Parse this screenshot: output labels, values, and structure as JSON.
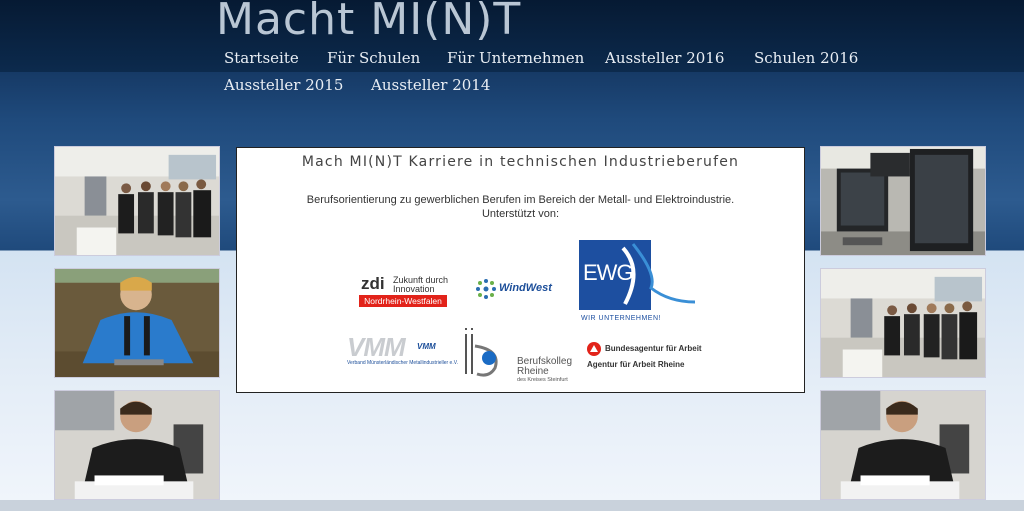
{
  "site": {
    "title": "Macht MI(N)T"
  },
  "nav": {
    "items": [
      {
        "label": "Startseite"
      },
      {
        "label": "Für Schulen"
      },
      {
        "label": "Für Unternehmen"
      },
      {
        "label": "Aussteller 2016"
      },
      {
        "label": "Schulen 2016"
      },
      {
        "label": "Aussteller 2015"
      },
      {
        "label": "Aussteller 2014"
      }
    ]
  },
  "content": {
    "title": "Mach MI(N)T  Karriere in technischen Industrieberufen",
    "line1": "Berufsorientierung zu gewerblichen Berufen im Bereich der Metall- und Elektroindustrie.",
    "line2": "Unterstützt von:"
  },
  "logos": {
    "zdi": {
      "mark": "zdi",
      "line1": "Zukunft durch",
      "line2": "Innovation",
      "region": "Nordrhein-Westfalen"
    },
    "windwest": {
      "name": "WindWest"
    },
    "ewg": {
      "mark": "EWG",
      "tagline": "WIR UNTERNEHMEN!"
    },
    "vmm": {
      "mark": "VMM",
      "caption": "Verband Münsterländischer Metallindustrieller e.V."
    },
    "berufskolleg": {
      "line1": "Berufskolleg",
      "line2": "Rheine",
      "line3": "des Kreises Steinfurt"
    },
    "arbeitsagentur": {
      "line1": "Bundesagentur für Arbeit",
      "line2": "Agentur für Arbeit Rheine"
    }
  },
  "colors": {
    "header_dark": "#0c2a4d",
    "ewg_blue": "#1d4fa0",
    "zdi_red": "#e2231a",
    "arbeit_red": "#e2231a"
  }
}
